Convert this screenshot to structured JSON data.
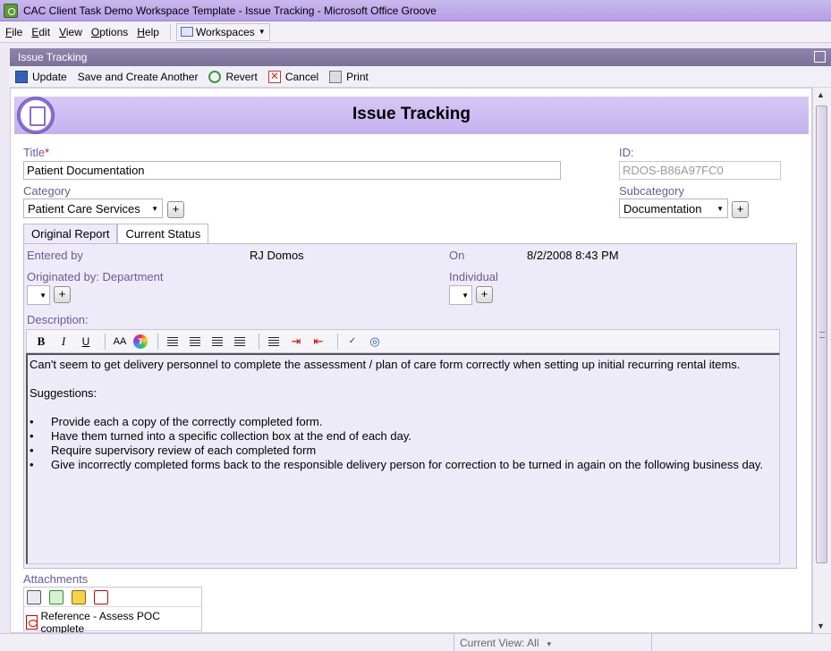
{
  "window": {
    "title": "CAC Client Task Demo Workspace Template - Issue Tracking - Microsoft Office Groove"
  },
  "menu": {
    "items": [
      {
        "label": "File",
        "key": "F",
        "rest": "ile"
      },
      {
        "label": "Edit",
        "key": "E",
        "rest": "dit"
      },
      {
        "label": "View",
        "key": "V",
        "rest": "iew"
      },
      {
        "label": "Options",
        "key": "O",
        "rest": "ptions"
      },
      {
        "label": "Help",
        "key": "H",
        "rest": "elp"
      }
    ],
    "workspaces_label": "Workspaces"
  },
  "tool": {
    "title": "Issue Tracking"
  },
  "actions": {
    "update": "Update",
    "save_and_create": "Save and Create Another",
    "revert": "Revert",
    "cancel": "Cancel",
    "print": "Print"
  },
  "form": {
    "title": "Issue Tracking",
    "title_label": "Title",
    "required_mark": "*",
    "title_value": "Patient Documentation",
    "id_label": "ID:",
    "id_value": "RDOS-B86A97FC0",
    "category_label": "Category",
    "category_value": "Patient Care Services",
    "subcategory_label": "Subcategory",
    "subcategory_value": "Documentation",
    "plus": "+"
  },
  "tabs": [
    {
      "label": "Original Report",
      "active": true
    },
    {
      "label": "Current Status",
      "active": false
    }
  ],
  "report": {
    "entered_by_label": "Entered by",
    "entered_by_value": "RJ Domos",
    "on_label": "On",
    "on_value": "8/2/2008 8:43 PM",
    "originated_label": "Originated by: Department",
    "individual_label": "Individual",
    "description_label": "Description:"
  },
  "editor": {
    "toolbar": {
      "bold": "B",
      "italic": "I",
      "underline": "U",
      "font_size": "AA",
      "color": "T"
    },
    "intro": "Can't seem to get delivery personnel to complete the assessment / plan of care form correctly when setting up initial recurring rental items.",
    "suggestions_heading": "Suggestions:",
    "bullets": [
      "Provide each a copy of the  correctly completed form.",
      "Have them turned into a specific collection box at the end of each day.",
      "Require supervisory review of each completed form",
      "Give incorrectly completed forms back to the responsible delivery person for correction to be turned in again on the following business day."
    ]
  },
  "attachments": {
    "label": "Attachments",
    "files": [
      {
        "name": "Reference - Assess POC complete"
      }
    ]
  },
  "status": {
    "current_view": "Current View: All"
  },
  "colors": {
    "title_bar": "#b69ee6",
    "banner": "#c4b1ee",
    "panel_bg": "#eeebf8",
    "label_text": "#6a5a9a",
    "required": "#d01010"
  }
}
